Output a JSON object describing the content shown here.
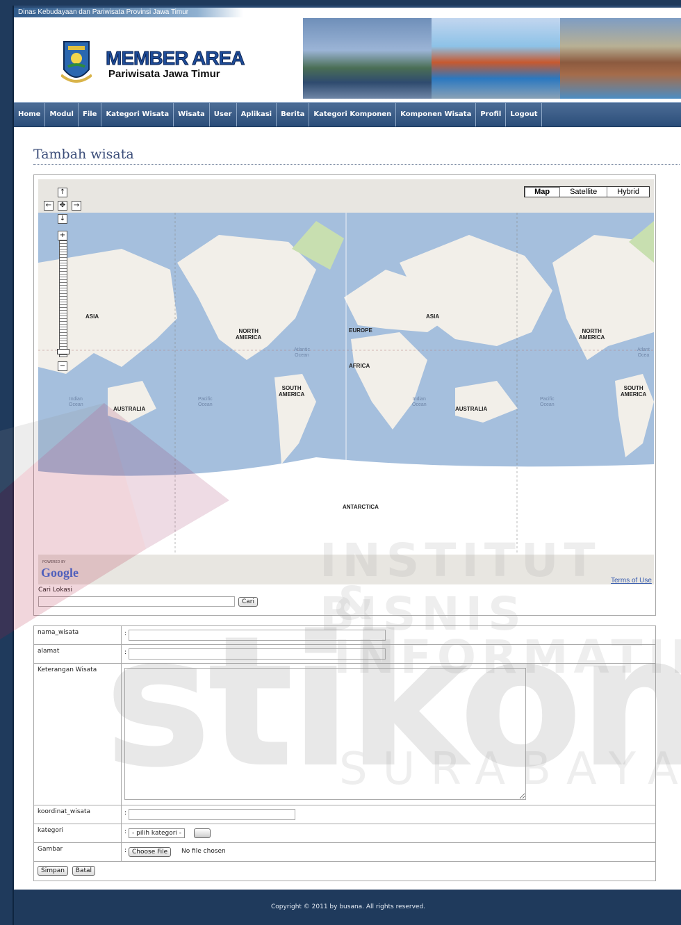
{
  "header": {
    "org_name": "Dinas Kebudayaan dan Pariwisata Provinsi Jawa Timur",
    "brand_title": "MEMBER AREA",
    "brand_subtitle": "Pariwisata Jawa Timur"
  },
  "nav": {
    "items": [
      "Home",
      "Modul",
      "File",
      "Kategori Wisata",
      "Wisata",
      "User",
      "Aplikasi",
      "Berita",
      "Kategori Komponen",
      "Komponen Wisata",
      "Profil",
      "Logout"
    ]
  },
  "main": {
    "title": "Tambah wisata"
  },
  "map": {
    "types": [
      "Map",
      "Satellite",
      "Hybrid"
    ],
    "active_type": "Map",
    "zoom_in": "+",
    "zoom_out": "−",
    "pan_up": "↑",
    "pan_down": "↓",
    "pan_left": "←",
    "pan_right": "→",
    "pan_center": "✥",
    "powered_by": "POWERED BY",
    "google": "Google",
    "terms": "Terms of Use",
    "labels": {
      "asia_1": "ASIA",
      "asia_2": "ASIA",
      "north_america_1": "NORTH\nAMERICA",
      "north_america_2": "NORTH\nAMERICA",
      "europe": "EUROPE",
      "africa": "AFRICA",
      "south_america_1": "SOUTH\nAMERICA",
      "south_america_2": "SOUTH\nAMERICA",
      "australia_1": "AUSTRALIA",
      "australia_2": "AUSTRALIA",
      "antarctica": "ANTARCTICA",
      "atlantic_1": "Atlantic\nOcean",
      "atlantic_2": "Atlant\nOcea",
      "indian_1": "Indian\nOcean",
      "indian_2": "Indian\nOcean",
      "pacific_1": "Pacific\nOcean",
      "pacific_2": "Pacific\nOcean"
    },
    "colors": {
      "water": "#a5bfdd",
      "land": "#f2efe9",
      "green": "#c8dfb0",
      "ice": "#ffffff"
    }
  },
  "search": {
    "label": "Cari Lokasi",
    "value": "",
    "button": "Cari"
  },
  "form": {
    "nama_label": "nama_wisata",
    "alamat_label": "alamat",
    "keterangan_label": "Keterangan Wisata",
    "koordinat_label": "koordinat_wisata",
    "kategori_label": "kategori",
    "kategori_selected": "- pilih kategori -",
    "gambar_label": "Gambar",
    "choose_file": "Choose File",
    "no_file": "No file chosen",
    "colon": ":",
    "submit": "Simpan",
    "cancel": "Batal"
  },
  "footer": {
    "copyright": "Copyright © 2011 by busana. All rights reserved."
  },
  "watermark": {
    "line1": "INSTITUT BISNIS",
    "line2": "& INFORMATIKA",
    "line3": "stikom",
    "line4": "SURABAYA"
  }
}
